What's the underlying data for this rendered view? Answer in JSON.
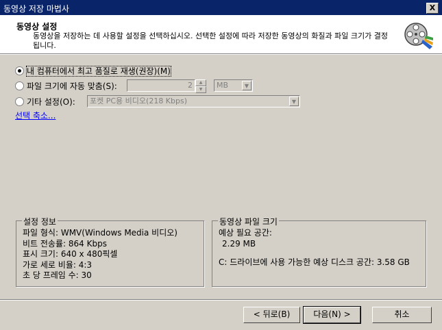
{
  "window": {
    "title": "동영상 저장 마법사",
    "close_label": "X"
  },
  "header": {
    "title": "동영상 설정",
    "description": "동영상을 저장하는 데 사용할 설정을 선택하십시오. 선택한 설정에 따라 저장한 동영상의 화질과 파일 크기가 결정됩니다.",
    "icon": "film-reel-icon"
  },
  "options": {
    "best_quality": "내 컴퓨터에서 최고 품질로 재생(권장)(M)",
    "fit_size": "파일 크기에 자동 맞춤(S):",
    "fit_size_value": "2",
    "fit_size_unit": "MB",
    "other": "기타 설정(O):",
    "other_value": "포켓 PC용 비디오(218 Kbps)",
    "selected": "best_quality"
  },
  "fewer_choices_link": "선택 축소...",
  "setting_info": {
    "legend": "설정 정보",
    "file_type": "파일 형식: WMV(Windows Media 비디오)",
    "bit_rate": "비트 전송률: 864 Kbps",
    "display_size": "표시 크기: 640 x 480픽셀",
    "aspect_ratio": "가로 세로 비율: 4:3",
    "fps": "초 당 프레임 수: 30"
  },
  "file_size": {
    "legend": "동영상 파일 크기",
    "estimated_label": "예상 필요 공간:",
    "estimated_value": "2.29 MB",
    "disk_space": "C: 드라이브에 사용 가능한 예상 디스크 공간: 3.58 GB"
  },
  "buttons": {
    "back": "< 뒤로(B)",
    "next": "다음(N) >",
    "cancel": "취소"
  }
}
